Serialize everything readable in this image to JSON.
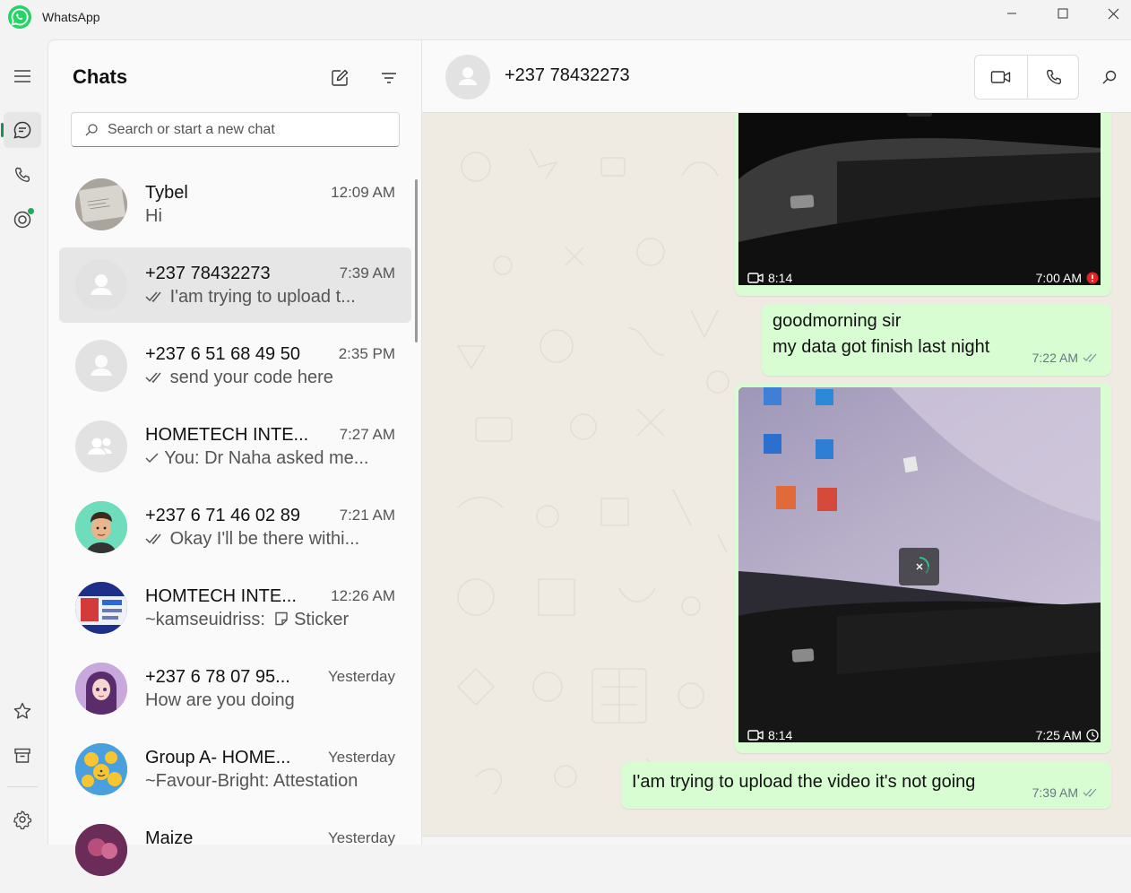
{
  "window": {
    "title": "WhatsApp"
  },
  "rail": {
    "items": [
      {
        "icon": "menu-icon"
      },
      {
        "icon": "chats-icon",
        "active": true
      },
      {
        "icon": "calls-icon"
      },
      {
        "icon": "status-icon",
        "unread_dot": true
      },
      {
        "icon": "starred-icon"
      },
      {
        "icon": "archived-icon"
      },
      {
        "icon": "settings-icon"
      }
    ]
  },
  "chatlist": {
    "title": "Chats",
    "search_placeholder": "Search or start a new chat",
    "chats": [
      {
        "name": "Tybel",
        "time": "12:09 AM",
        "preview": "Hi",
        "ticks": ""
      },
      {
        "name": "+237 78432273",
        "time": "7:39 AM",
        "preview": "I'am trying to upload t...",
        "ticks": "double",
        "selected": true
      },
      {
        "name": "+237 6 51 68 49 50",
        "time": "2:35 PM",
        "preview": "send your code here",
        "ticks": "double"
      },
      {
        "name": "HOMETECH INTE...",
        "time": "7:27 AM",
        "preview": "You: Dr Naha asked me...",
        "ticks": "single"
      },
      {
        "name": "+237 6 71 46 02 89",
        "time": "7:21 AM",
        "preview": "Okay I'll be there withi...",
        "ticks": "double"
      },
      {
        "name": "HOMTECH INTE...",
        "time": "12:26 AM",
        "preview": "~kamseuidriss:",
        "sticker_label": "Sticker",
        "ticks": ""
      },
      {
        "name": "+237 6 78 07 95...",
        "time": "Yesterday",
        "preview": "How are you doing",
        "ticks": ""
      },
      {
        "name": "Group A- HOME...",
        "time": "Yesterday",
        "preview": "~Favour-Bright: Attestation",
        "ticks": ""
      },
      {
        "name": "Maize",
        "time": "Yesterday",
        "preview": "",
        "ticks": ""
      }
    ]
  },
  "conversation": {
    "contact_name": "+237 78432273",
    "messages": [
      {
        "type": "video",
        "duration": "8:14",
        "time": "7:00 AM",
        "status": "error"
      },
      {
        "type": "text",
        "lines": [
          "goodmorning sir",
          "my data got finish last night"
        ],
        "time": "7:22 AM",
        "status": "read"
      },
      {
        "type": "video",
        "duration": "8:14",
        "time": "7:25 AM",
        "status": "pending",
        "uploading": true
      },
      {
        "type": "text",
        "lines": [
          "I'am trying to upload the video it's not going"
        ],
        "time": "7:39 AM",
        "status": "read"
      }
    ]
  },
  "colors": {
    "accent": "#1daa61",
    "bubble_out": "#d9fdd3",
    "wallpaper": "#efeae2",
    "error": "#e02424"
  }
}
